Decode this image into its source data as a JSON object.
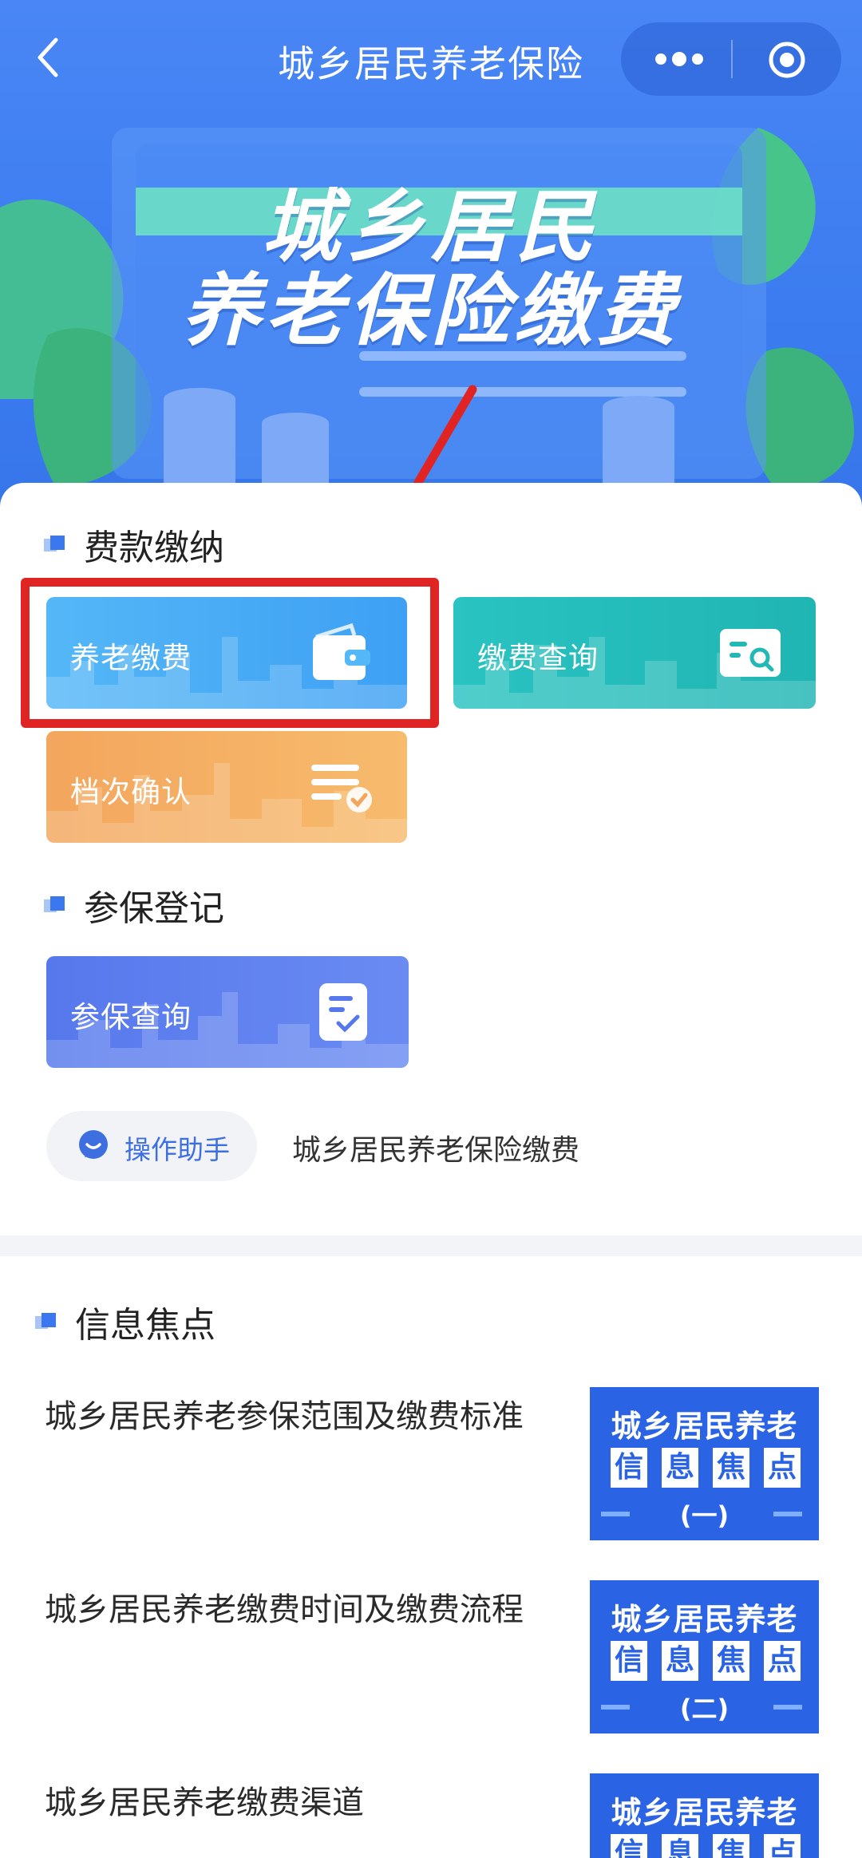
{
  "nav": {
    "title": "城乡居民养老保险"
  },
  "banner": {
    "line1": "城乡居民",
    "line2": "养老保险缴费"
  },
  "sections": {
    "payment": {
      "title": "费款缴纳"
    },
    "insured": {
      "title": "参保登记"
    },
    "news": {
      "title": "信息焦点"
    }
  },
  "tiles": {
    "pension_payment": "养老缴费",
    "payment_query": "缴费查询",
    "grade_confirm": "档次确认",
    "insured_query": "参保查询"
  },
  "helper": {
    "label": "操作助手",
    "text": "城乡居民养老保险缴费"
  },
  "news": [
    {
      "title": "城乡居民养老参保范围及缴费标准",
      "thumb_l1": "城乡居民养老",
      "thumb_l2": [
        "信",
        "息",
        "焦",
        "点"
      ],
      "thumb_l3": "(一)"
    },
    {
      "title": "城乡居民养老缴费时间及缴费流程",
      "thumb_l1": "城乡居民养老",
      "thumb_l2": [
        "信",
        "息",
        "焦",
        "点"
      ],
      "thumb_l3": "(二)"
    },
    {
      "title": "城乡居民养老缴费渠道",
      "thumb_l1": "城乡居民养老",
      "thumb_l2": [
        "信",
        "息",
        "焦",
        "点"
      ],
      "thumb_l3": ""
    }
  ],
  "colors": {
    "primary": "#3b7cf0",
    "annotation_red": "#e02424"
  },
  "icons": [
    "back-arrow-icon",
    "more-dots-icon",
    "target-icon",
    "wallet-icon",
    "receipt-search-icon",
    "list-check-icon",
    "document-check-icon",
    "chat-bubble-icon"
  ]
}
